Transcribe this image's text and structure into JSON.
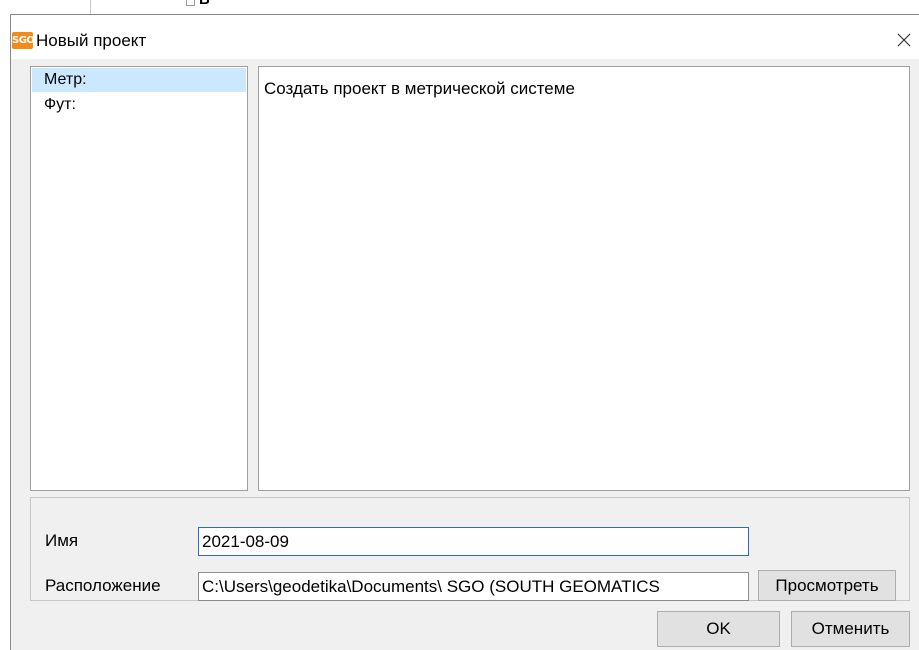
{
  "background": {
    "fragment_text": "В"
  },
  "dialog": {
    "icon_text": "SGO",
    "title": "Новый проект",
    "accent_color": "#f28a1d",
    "selection_color": "#cce8ff"
  },
  "unit_list": {
    "items": [
      {
        "label": "Метр:",
        "selected": true
      },
      {
        "label": "Фут:",
        "selected": false
      }
    ]
  },
  "description": {
    "text": "Создать проект в метрической системе"
  },
  "form": {
    "name_label": "Имя",
    "name_value": "2021-08-09",
    "location_label": "Расположение",
    "location_value": "C:\\Users\\geodetika\\Documents\\ SGO (SOUTH GEOMATICS",
    "browse_label": "Просмотреть"
  },
  "buttons": {
    "ok_label": "OK",
    "cancel_label": "Отменить"
  }
}
